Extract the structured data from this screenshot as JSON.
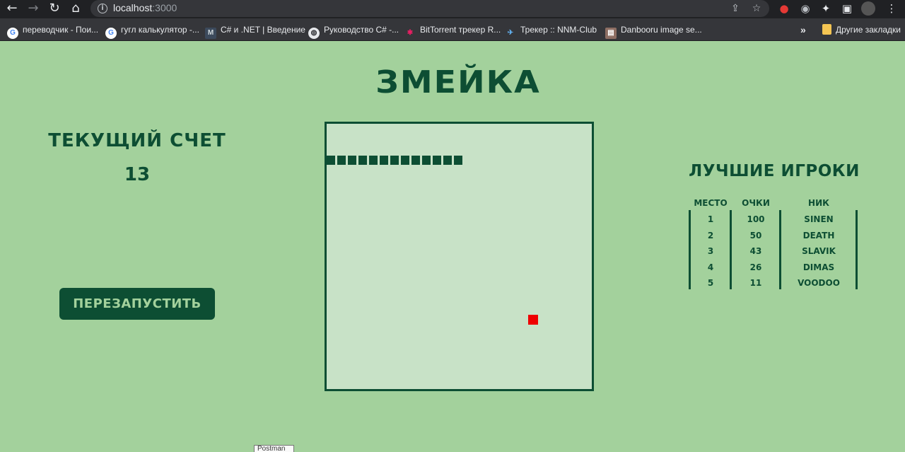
{
  "browser": {
    "url_host": "localhost",
    "url_port": ":3000",
    "bookmarks": [
      {
        "label": "переводчик - Пои...",
        "icon": "google-icon"
      },
      {
        "label": "гугл калькулятор -...",
        "icon": "google-icon"
      },
      {
        "label": "C# и .NET | Введение",
        "icon": "metanit-icon"
      },
      {
        "label": "Руководство C# -...",
        "icon": "globe-icon"
      },
      {
        "label": "BitTorrent трекер R...",
        "icon": "rutracker-icon"
      },
      {
        "label": "Трекер :: NNM-Club",
        "icon": "nnm-icon"
      },
      {
        "label": "Danbooru image se...",
        "icon": "danbooru-icon"
      }
    ],
    "overflow_chevron": "»",
    "other_bookmarks": "Другие закладки"
  },
  "game": {
    "title": "ЗМЕЙКА",
    "score_label": "ТЕКУЩИЙ СЧЕТ",
    "score_value": "13",
    "restart_label": "ПЕРЕЗАПУСТИТЬ",
    "snake_length": 13,
    "food_color": "#ee0000",
    "snake_color": "#0d4e33"
  },
  "leaderboard": {
    "title": "ЛУЧШИЕ ИГРОКИ",
    "columns": [
      "МЕСТО",
      "ОЧКИ",
      "НИК"
    ],
    "rows": [
      [
        "1",
        "100",
        "SINEN"
      ],
      [
        "2",
        "50",
        "DEATH"
      ],
      [
        "3",
        "43",
        "SLAVIK"
      ],
      [
        "4",
        "26",
        "DIMAS"
      ],
      [
        "5",
        "11",
        "VOODOO"
      ]
    ]
  },
  "tooltip": "Postman",
  "colors": {
    "background": "#a3d19c",
    "board": "#c8e2c7",
    "accent": "#0d4e33"
  }
}
